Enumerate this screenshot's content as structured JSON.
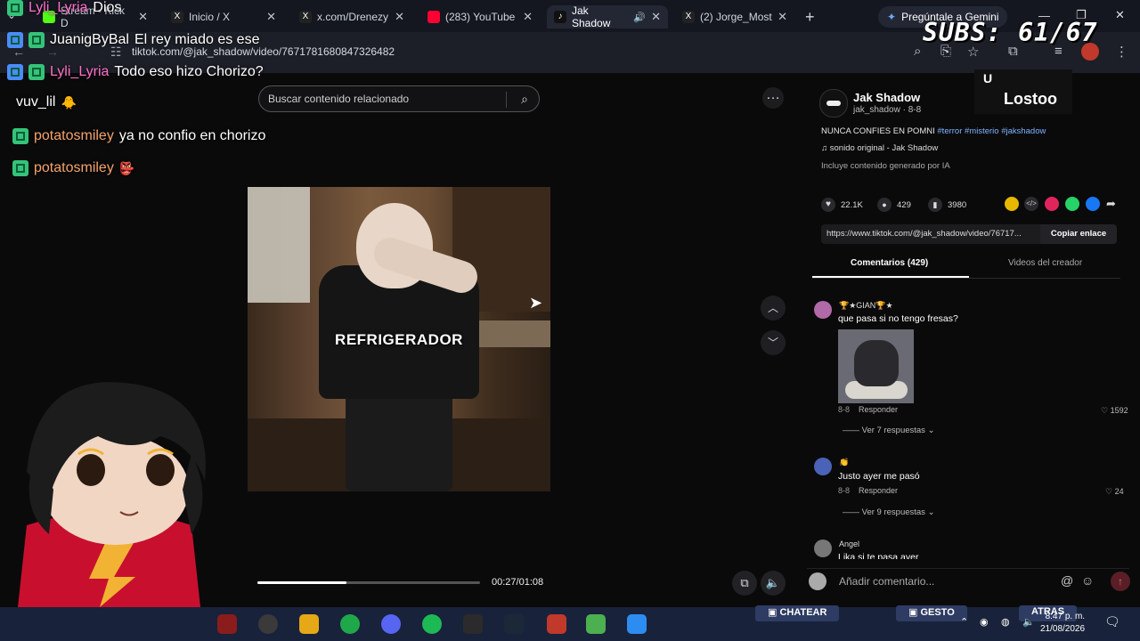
{
  "tabs": [
    {
      "label": "Stream - Kick D",
      "color": "#53fc18"
    },
    {
      "label": "Inicio / X",
      "color": "#e7e9ea"
    },
    {
      "label": "x.com/Drenezy",
      "color": "#e7e9ea"
    },
    {
      "label": "(283) YouTube",
      "color": "#ff0033"
    },
    {
      "label": "Jak Shadow",
      "color": "#ffffff"
    },
    {
      "label": "(2) Jorge_Most",
      "color": "#e7e9ea"
    }
  ],
  "gemini_button": "Pregúntale a Gemini",
  "address": {
    "url": "tiktok.com/@jak_shadow/video/7671781680847326482"
  },
  "chat": [
    {
      "user": "Lyli_Lyria",
      "text": "Dios",
      "user_color": "#ff6fc8"
    },
    {
      "user": "JuanigByBal",
      "text": "El rey miado es ese",
      "user_color": "#ffffff"
    },
    {
      "user": "Lyli_Lyria",
      "text": "Todo eso hizo Chorizo?",
      "user_color": "#ff6fc8"
    },
    {
      "user": "vuv_lil",
      "text": "",
      "user_color": "#ffffff"
    },
    {
      "user": "potatosmiley",
      "text": "ya no confio en chorizo",
      "user_color": "#f6a46b"
    },
    {
      "user": "potatosmiley",
      "text": "",
      "user_color": "#f6a46b"
    }
  ],
  "search": {
    "placeholder": "Buscar contenido relacionado"
  },
  "video": {
    "caption": "REFRIGERADOR",
    "time": "00:27/01:08",
    "progress": 0.4
  },
  "creator": {
    "name": "Jak Shadow",
    "handle": "jak_shadow · 8-8",
    "desc_text": "NUNCA CONFIES EN POMNI",
    "tags": "#terror #misterio #jakshadow",
    "music": "sonido original - Jak Shadow",
    "ai_note": "Incluye contenido generado por IA"
  },
  "stats": {
    "likes": "22.1K",
    "comments": "429",
    "saves": "3980"
  },
  "share": {
    "url": "https://www.tiktok.com/@jak_shadow/video/76717...",
    "copy_label": "Copiar enlace"
  },
  "panel_tabs": {
    "comments": "Comentarios (429)",
    "creator_videos": "Videos del creador"
  },
  "comments": [
    {
      "user": "🏆★GIAN🏆★",
      "text": "que pasa si no tengo fresas?",
      "date": "8-8",
      "reply": "Responder",
      "likes": "1592",
      "replies": "Ver 7 respuestas"
    },
    {
      "user": "👏",
      "text": "Justo ayer me pasó",
      "date": "8-8",
      "reply": "Responder",
      "likes": "24",
      "replies": "Ver 9 respuestas"
    },
    {
      "user": "Angel",
      "text": "Lika si te pasa ayer"
    }
  ],
  "comment_input": {
    "placeholder": "Añadir comentario..."
  },
  "overlay": {
    "subs": "SUBS: 61/67",
    "viewer_name": "Lostoo",
    "viewer_initial": "U"
  },
  "taskbar": {
    "banner_left": "CHATEAR",
    "banner_mid": "GESTO",
    "banner_right": "ATRAS",
    "time": "8:47 p. m.",
    "date": "21/08/2026"
  }
}
